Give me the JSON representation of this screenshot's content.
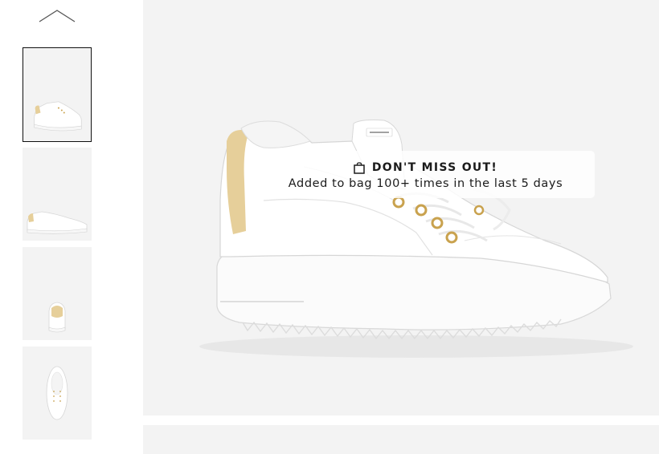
{
  "gallery": {
    "scroll_up_icon": "chevron-up-icon",
    "thumbnails": [
      {
        "view": "angled side view",
        "selected": true
      },
      {
        "view": "side view",
        "selected": false
      },
      {
        "view": "back view",
        "selected": false
      },
      {
        "view": "top view",
        "selected": false
      }
    ]
  },
  "main_image": {
    "subject": "white platform sneaker with gold eyelets and gold heel tab"
  },
  "toast": {
    "icon": "shopping-bag-icon",
    "title": "DON'T MISS OUT!",
    "message": "Added to bag 100+ times in the last 5 days"
  },
  "colors": {
    "background": "#ffffff",
    "image_bg": "#f3f3f3",
    "text": "#1b1b1b",
    "gold_accent": "#e6cf9a",
    "selected_border": "#111111"
  }
}
